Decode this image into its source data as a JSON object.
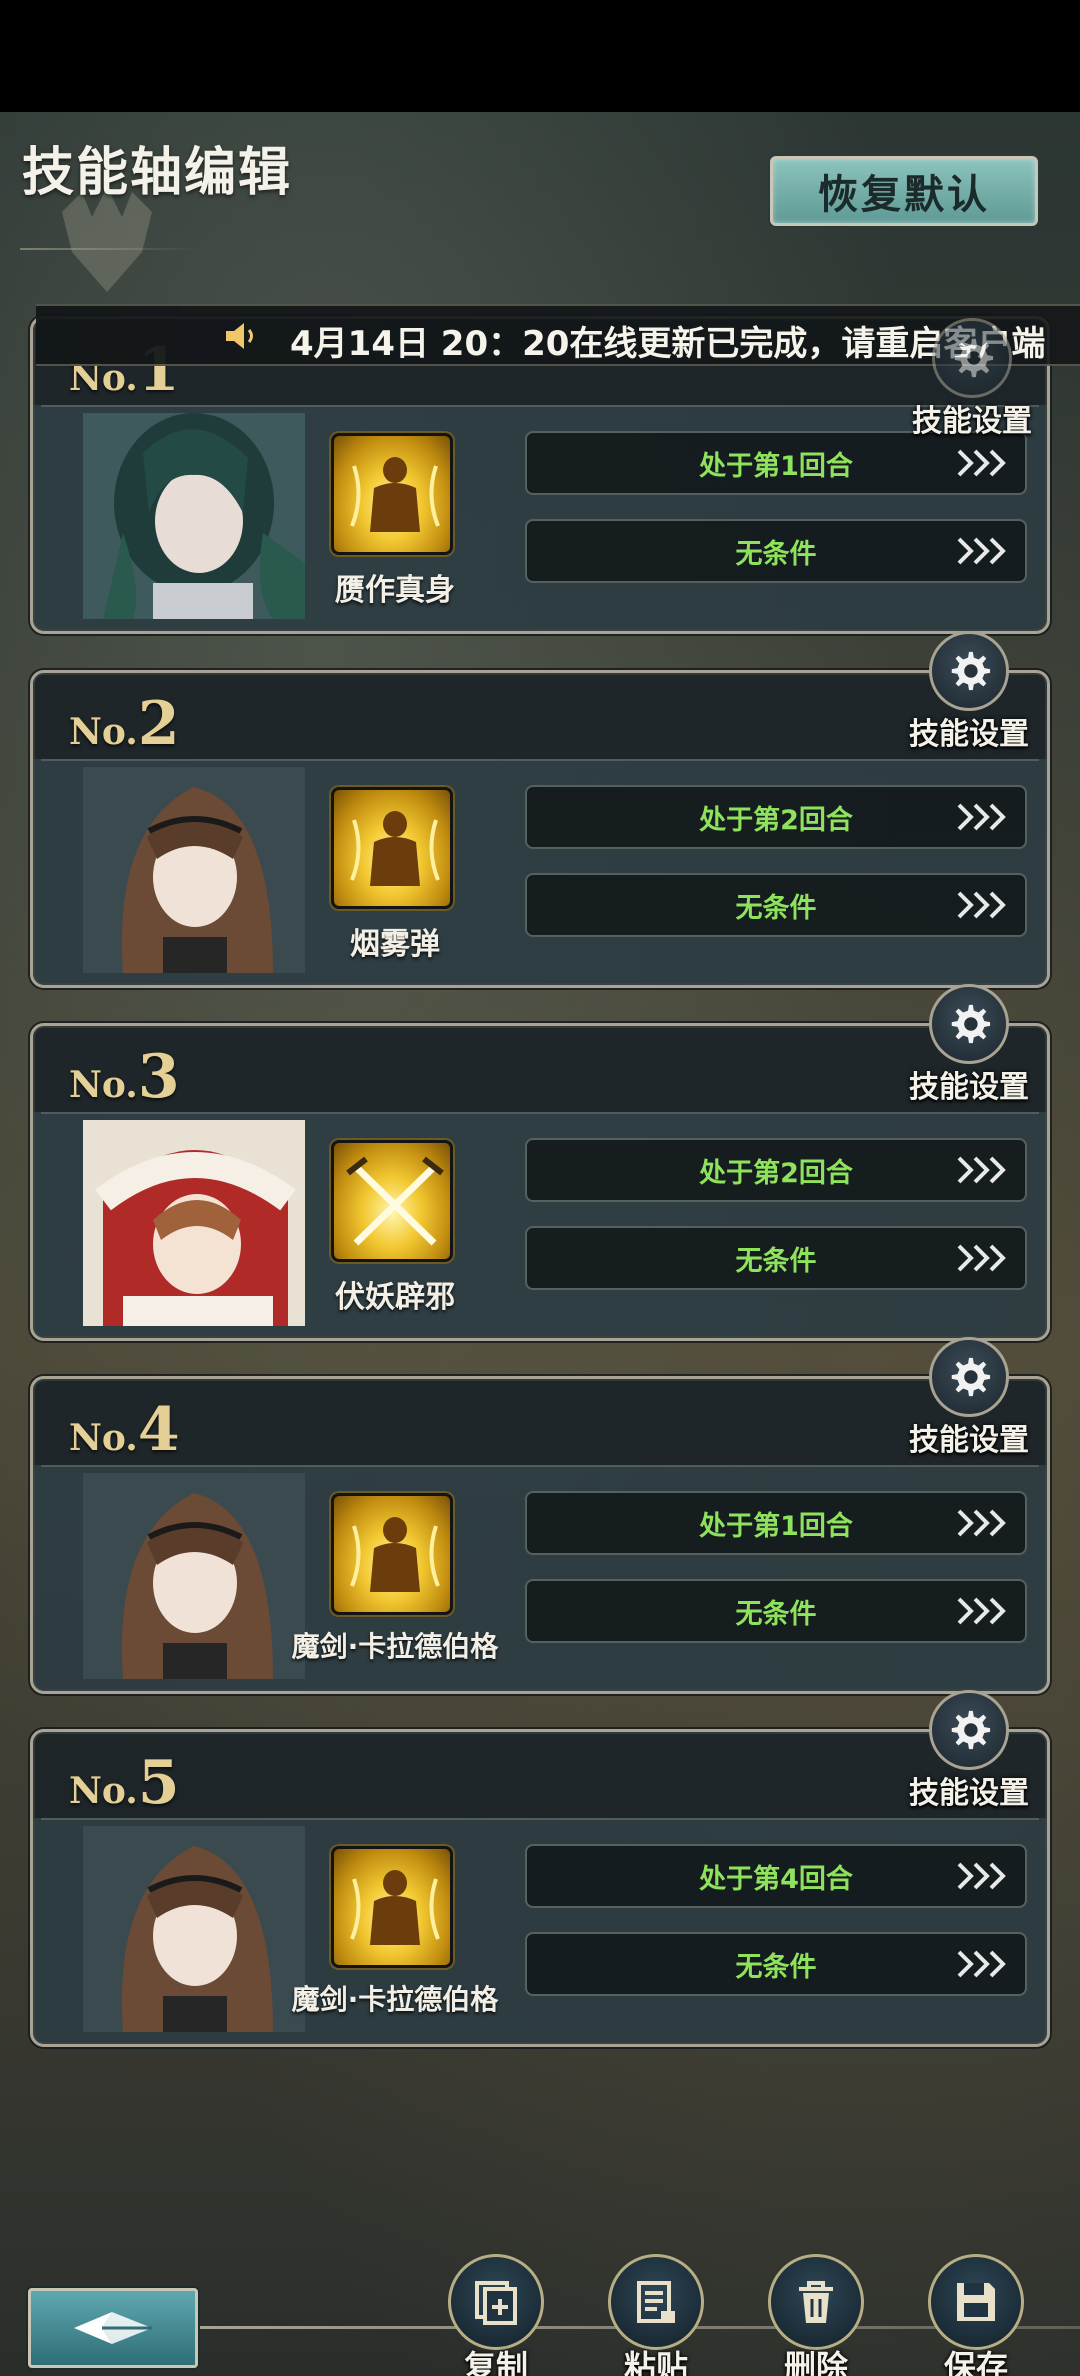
{
  "header": {
    "title": "技能轴编辑",
    "reset_label": "恢复默认"
  },
  "ticker": {
    "text": "4月14日 20：20在线更新已完成，请重启客户端"
  },
  "gear_label": "技能设置",
  "cards": [
    {
      "no_label": "No.",
      "number": "1",
      "skill_name": "赝作真身",
      "condition1": "处于第1回合",
      "condition2": "无条件"
    },
    {
      "no_label": "No.",
      "number": "2",
      "skill_name": "烟雾弹",
      "condition1": "处于第2回合",
      "condition2": "无条件"
    },
    {
      "no_label": "No.",
      "number": "3",
      "skill_name": "伏妖辟邪",
      "condition1": "处于第2回合",
      "condition2": "无条件"
    },
    {
      "no_label": "No.",
      "number": "4",
      "skill_name": "魔剑·卡拉德伯格",
      "condition1": "处于第1回合",
      "condition2": "无条件"
    },
    {
      "no_label": "No.",
      "number": "5",
      "skill_name": "魔剑·卡拉德伯格",
      "condition1": "处于第4回合",
      "condition2": "无条件"
    }
  ],
  "actions": {
    "copy": "复制",
    "paste": "粘贴",
    "delete": "删除",
    "save": "保存"
  },
  "colors": {
    "condition_text": "#8fe25c",
    "number_gold": "#e4cf96",
    "reset_button": "#7ab3ad"
  }
}
